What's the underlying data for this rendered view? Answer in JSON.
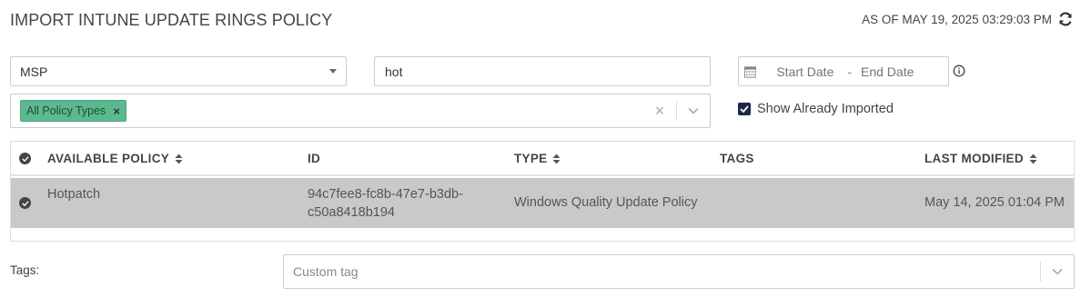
{
  "header": {
    "title": "IMPORT INTUNE UPDATE RINGS POLICY",
    "as_of": "AS OF MAY 19, 2025 03:29:03 PM"
  },
  "filters": {
    "scope_select": {
      "value": "MSP"
    },
    "search": {
      "value": "hot"
    },
    "date_range": {
      "start_placeholder": "Start Date",
      "separator": "-",
      "end_placeholder": "End Date"
    },
    "policy_types": {
      "chips": [
        {
          "label": "All Policy Types",
          "remove": "×"
        }
      ],
      "clear": "×"
    },
    "show_imported": {
      "label": "Show Already Imported",
      "checked": true
    }
  },
  "table": {
    "columns": [
      {
        "label": "AVAILABLE POLICY",
        "sortable": true
      },
      {
        "label": "ID",
        "sortable": false
      },
      {
        "label": "TYPE",
        "sortable": true
      },
      {
        "label": "TAGS",
        "sortable": false
      },
      {
        "label": "LAST MODIFIED",
        "sortable": true
      }
    ],
    "rows": [
      {
        "selected": true,
        "name": "Hotpatch",
        "id_line1": "94c7fee8-fc8b-47e7-b3db-",
        "id_line2": "c50a8418b194",
        "type": "Windows Quality Update Policy",
        "tags": "",
        "last_modified": "May 14, 2025 01:04 PM"
      }
    ]
  },
  "tags": {
    "label": "Tags:",
    "placeholder": "Custom tag"
  },
  "colors": {
    "chip_bg": "#5cb98f",
    "selected_row_bg": "#c9c9c9",
    "checkbox_bg": "#1d2845"
  }
}
